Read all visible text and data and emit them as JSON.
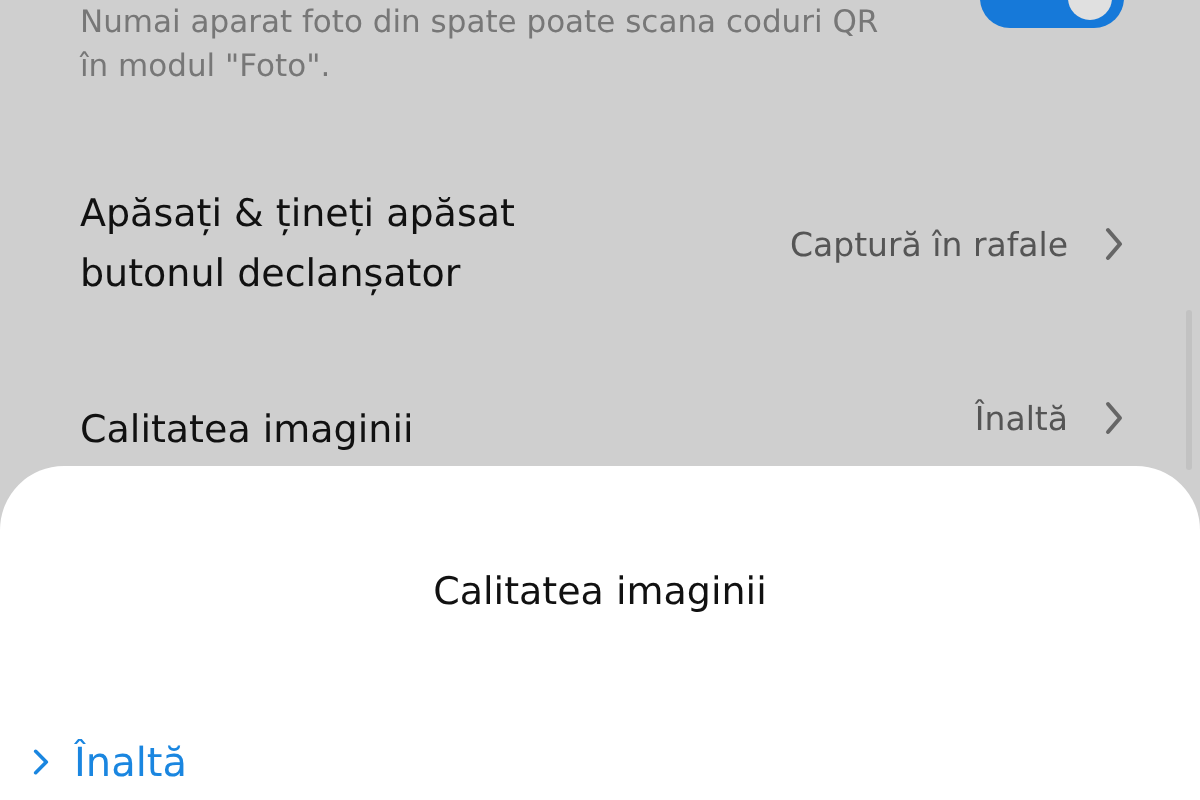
{
  "settings": [
    {
      "kind": "toggle",
      "description": "Numai aparat foto din spate poate scana coduri QR în modul \"Foto\".",
      "on": true
    },
    {
      "kind": "link",
      "title": "Apăsați & țineți apăsat butonul declanșator",
      "value": "Captură în rafale"
    },
    {
      "kind": "link",
      "title": "Calitatea imaginii",
      "value": "Înaltă"
    }
  ],
  "sheet": {
    "title": "Calitatea imaginii",
    "options": [
      {
        "label": "Înaltă",
        "selected": true
      }
    ]
  }
}
